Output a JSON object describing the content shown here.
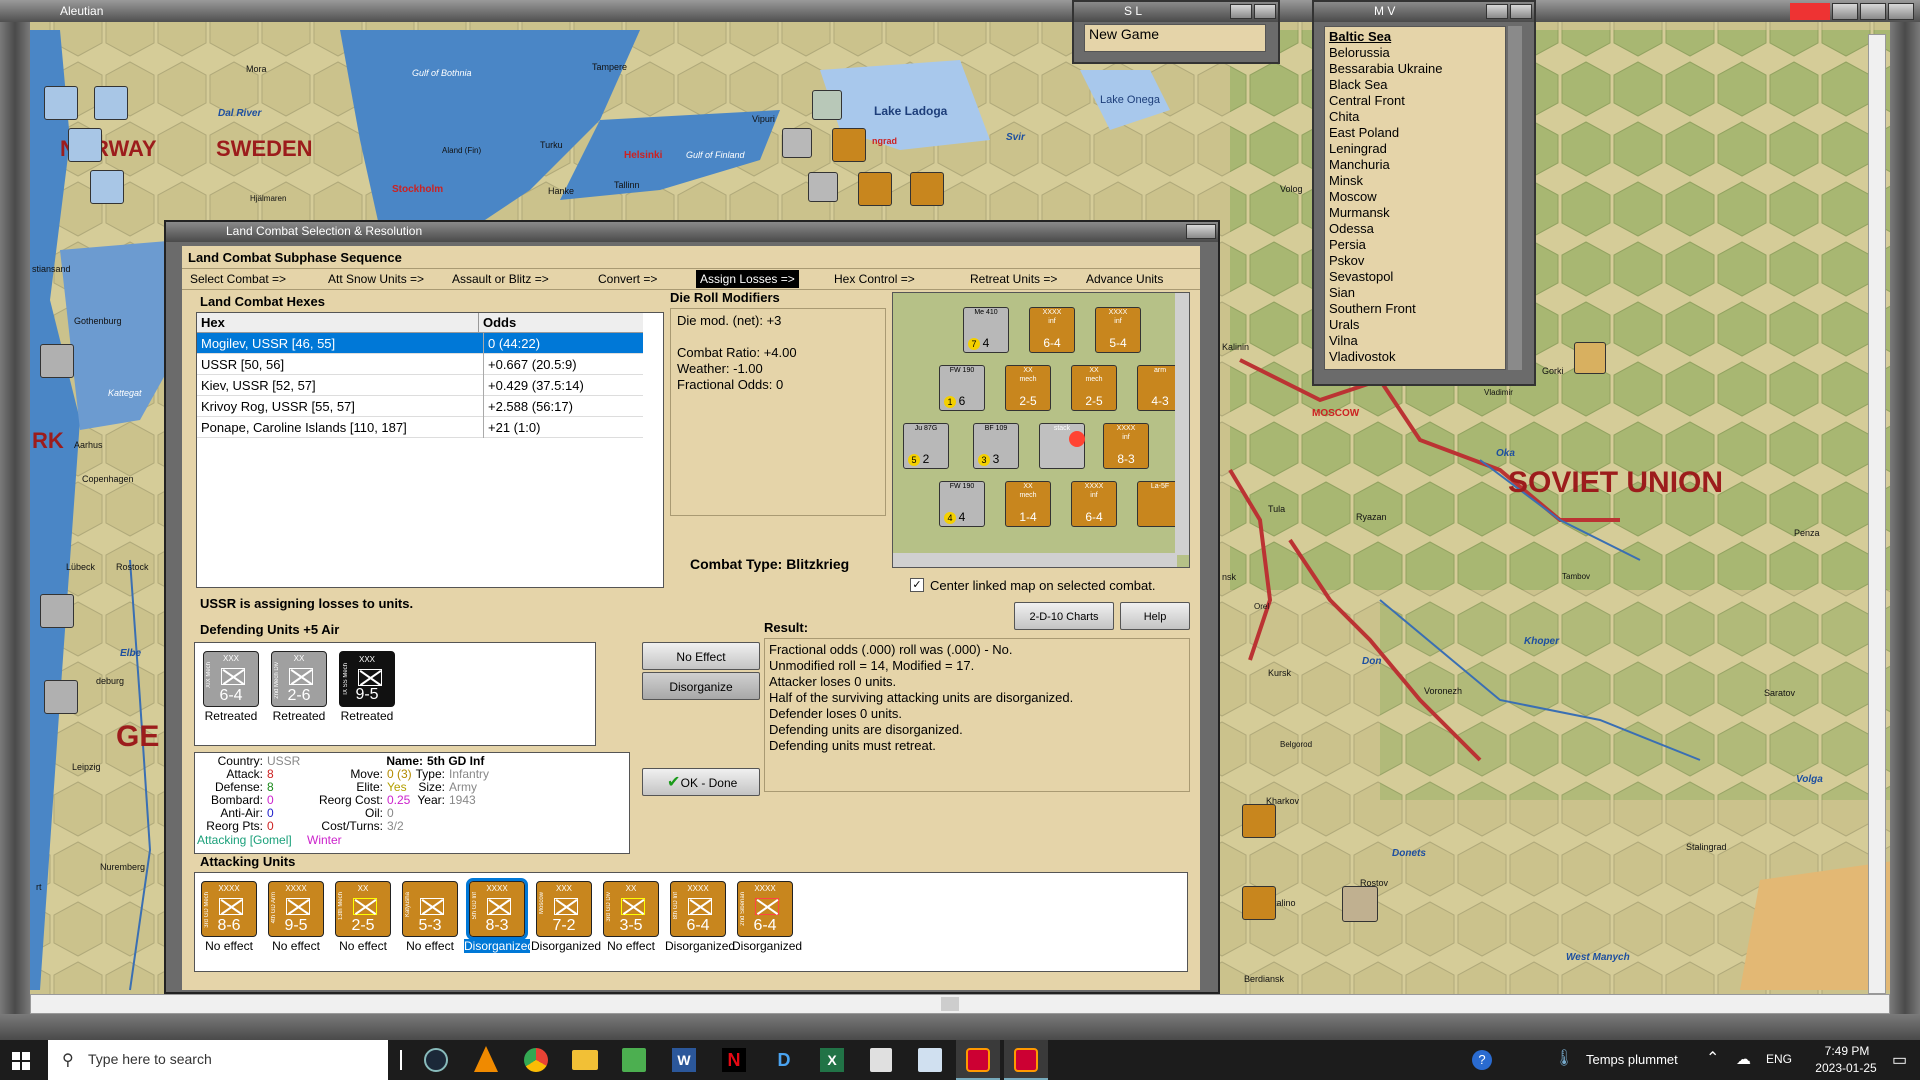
{
  "app": {
    "title": "Aleutian"
  },
  "map_labels": [
    {
      "text": "NORWAY",
      "kind": "country"
    },
    {
      "text": "SWEDEN",
      "kind": "country"
    },
    {
      "text": "RK",
      "kind": "country"
    },
    {
      "text": "GE",
      "kind": "country"
    },
    {
      "text": "SOVIET UNION",
      "kind": "country"
    },
    {
      "text": "Gulf of Bothnia",
      "kind": "sea"
    },
    {
      "text": "Gulf of Finland",
      "kind": "sea"
    },
    {
      "text": "Kattegat",
      "kind": "sea"
    },
    {
      "text": "Lake Ladoga",
      "kind": "sea"
    },
    {
      "text": "Lake Onega",
      "kind": "sea"
    },
    {
      "text": "Dal River",
      "kind": "river"
    },
    {
      "text": "Svir",
      "kind": "river"
    },
    {
      "text": "Oka",
      "kind": "river"
    },
    {
      "text": "Khoper",
      "kind": "river"
    },
    {
      "text": "Don",
      "kind": "river"
    },
    {
      "text": "Donets",
      "kind": "river"
    },
    {
      "text": "Volga",
      "kind": "river"
    },
    {
      "text": "Elbe",
      "kind": "river"
    },
    {
      "text": "West Manych",
      "kind": "river"
    },
    {
      "text": "Stockholm",
      "kind": "capital"
    },
    {
      "text": "Helsinki",
      "kind": "capital"
    },
    {
      "text": "MOSCOW",
      "kind": "capital"
    },
    {
      "text": "Mora",
      "kind": "city"
    },
    {
      "text": "Tampere",
      "kind": "city"
    },
    {
      "text": "Turku",
      "kind": "city"
    },
    {
      "text": "Hanke",
      "kind": "city"
    },
    {
      "text": "Tallinn",
      "kind": "city"
    },
    {
      "text": "Aland (Fin)",
      "kind": "city"
    },
    {
      "text": "Hjälmaren",
      "kind": "city"
    },
    {
      "text": "Gothenburg",
      "kind": "city"
    },
    {
      "text": "Aarhus",
      "kind": "city"
    },
    {
      "text": "Copenhagen",
      "kind": "city"
    },
    {
      "text": "Lübeck",
      "kind": "city"
    },
    {
      "text": "Rostock",
      "kind": "city"
    },
    {
      "text": "Leipzig",
      "kind": "city"
    },
    {
      "text": "Nuremberg",
      "kind": "city"
    },
    {
      "text": "Vipuri",
      "kind": "city"
    },
    {
      "text": "Volog",
      "kind": "city"
    },
    {
      "text": "Gorki",
      "kind": "city"
    },
    {
      "text": "Vladimir",
      "kind": "city"
    },
    {
      "text": "Kalinin",
      "kind": "city"
    },
    {
      "text": "Tula",
      "kind": "city"
    },
    {
      "text": "Ryazan",
      "kind": "city"
    },
    {
      "text": "Penza",
      "kind": "city"
    },
    {
      "text": "Tambov",
      "kind": "city"
    },
    {
      "text": "Orel",
      "kind": "city"
    },
    {
      "text": "Kursk",
      "kind": "city"
    },
    {
      "text": "Voronezh",
      "kind": "city"
    },
    {
      "text": "Saratov",
      "kind": "city"
    },
    {
      "text": "Belgorod",
      "kind": "city"
    },
    {
      "text": "Kharkov",
      "kind": "city"
    },
    {
      "text": "Stalingrad",
      "kind": "city"
    },
    {
      "text": "Rostov",
      "kind": "city"
    },
    {
      "text": "Stalino",
      "kind": "city"
    },
    {
      "text": "Berdiansk",
      "kind": "city"
    },
    {
      "text": "stiansand",
      "kind": "city"
    },
    {
      "text": "deburg",
      "kind": "city"
    },
    {
      "text": "rt",
      "kind": "city"
    },
    {
      "text": "nsk",
      "kind": "city"
    },
    {
      "text": "ngrad",
      "kind": "city"
    }
  ],
  "sl_window": {
    "title": "S L",
    "item": "New Game"
  },
  "mv_window": {
    "title": "M V",
    "items": [
      "Baltic Sea",
      "Belorussia",
      "Bessarabia Ukraine",
      "Black Sea",
      "Central Front",
      "Chita",
      "East Poland",
      "Leningrad",
      "Manchuria",
      "Minsk",
      "Moscow",
      "Murmansk",
      "Odessa",
      "Persia",
      "Pskov",
      "Sevastopol",
      "Sian",
      "Southern Front",
      "Urals",
      "Vilna",
      "Vladivostok"
    ]
  },
  "dialog": {
    "title": "Land Combat Selection & Resolution",
    "sequence": {
      "heading": "Land Combat Subphase Sequence",
      "steps": [
        "Select Combat =>",
        "Att Snow Units =>",
        "Assault or Blitz =>",
        "Convert =>",
        "Assign Losses =>",
        "Hex Control =>",
        "Retreat Units =>",
        "Advance Units"
      ],
      "active_index": 4
    },
    "hexes": {
      "heading": "Land Combat Hexes",
      "col_hex": "Hex",
      "col_odds": "Odds",
      "rows": [
        {
          "hex": "Mogilev, USSR [46, 55]",
          "odds": "0 (44:22)"
        },
        {
          "hex": "USSR [50, 56]",
          "odds": "+0.667 (20.5:9)"
        },
        {
          "hex": "Kiev, USSR [52, 57]",
          "odds": "+0.429 (37.5:14)"
        },
        {
          "hex": "Krivoy Rog, USSR [55, 57]",
          "odds": "+2.588 (56:17)"
        },
        {
          "hex": "Ponape, Caroline Islands [110, 187]",
          "odds": "+21 (1:0)"
        }
      ]
    },
    "modifiers": {
      "heading": "Die Roll Modifiers",
      "net": "Die mod. (net): +3",
      "ratio": "Combat Ratio: +4.00",
      "weather": "Weather: -1.00",
      "fractional": "Fractional Odds: 0"
    },
    "combat_type": "Combat Type:  Blitzkrieg",
    "center_map": "Center linked map on selected combat.",
    "charts_btn": "2-D-10 Charts",
    "help_btn": "Help",
    "status": "USSR is assigning losses to units.",
    "defending_heading": "Defending Units +5 Air",
    "defenders": [
      {
        "size": "XXX",
        "value": "6-4",
        "status": "Retreated",
        "name": "XIX Mech"
      },
      {
        "size": "XX",
        "value": "2-6",
        "status": "Retreated",
        "name": "2nd Mech Div"
      },
      {
        "size": "XXX",
        "value": "9-5",
        "status": "Retreated",
        "name": "IX SS Mech"
      }
    ],
    "no_effect_btn": "No Effect",
    "disorganize_btn": "Disorganize",
    "ok_btn": "OK - Done",
    "result_heading": "Result:",
    "result_lines": [
      "Fractional odds (.000) roll was (.000)  - No.",
      "Unmodified roll = 14, Modified = 17.",
      "Attacker loses 0 units.",
      "Half of the surviving attacking units are disorganized.",
      "Defender loses 0 units.",
      "Defending units are disorganized.",
      "Defending units must retreat."
    ],
    "unit": {
      "country_label": "Country:",
      "country": "USSR",
      "attack_label": "Attack:",
      "attack": "8",
      "defense_label": "Defense:",
      "defense": "8",
      "bombard_label": "Bombard:",
      "bombard": "0",
      "antiair_label": "Anti-Air:",
      "antiair": "0",
      "reorg_label": "Reorg Pts:",
      "reorg": "0",
      "attacking": "Attacking [Gomel]",
      "season": "Winter",
      "name_label": "Name:",
      "name": "5th GD Inf",
      "move_label": "Move:",
      "move": "0",
      "move_max": "(3)",
      "type_label": "Type:",
      "type": "Infantry",
      "elite_label": "Elite:",
      "elite": "Yes",
      "size_label": "Size:",
      "size": "Army",
      "reorg_cost_label": "Reorg Cost:",
      "reorg_cost": "0.25",
      "year_label": "Year:",
      "year": "1943",
      "oil_label": "Oil:",
      "oil": "0",
      "cost_label": "Cost/Turns:",
      "cost": "3/2"
    },
    "attacking_heading": "Attacking Units",
    "attackers": [
      {
        "size": "XXXX",
        "value": "8-6",
        "status": "No effect",
        "name": "3rd GD Mech"
      },
      {
        "size": "XXXX",
        "value": "9-5",
        "status": "No effect",
        "name": "4th GD Arm"
      },
      {
        "size": "XX",
        "value": "2-5",
        "status": "No effect",
        "name": "13th Mech"
      },
      {
        "size": "",
        "value": "5-3",
        "status": "No effect",
        "name": "Katyusha"
      },
      {
        "size": "XXXX",
        "value": "8-3",
        "status": "Disorganized",
        "name": "5th GD Inf"
      },
      {
        "size": "XXX",
        "value": "7-2",
        "status": "Disorganized",
        "name": "Moscow"
      },
      {
        "size": "XX",
        "value": "3-5",
        "status": "No effect",
        "name": "3rd GD Div"
      },
      {
        "size": "XXXX",
        "value": "6-4",
        "status": "Disorganized",
        "name": "8th GD Inf"
      },
      {
        "size": "XXXX",
        "value": "6-4",
        "status": "Disorganized",
        "name": "2nd Siberian"
      }
    ],
    "minimap_counters": [
      {
        "top": "",
        "value": "4",
        "extra": "7",
        "name": "Me 410"
      },
      {
        "top": "XXXX",
        "value": "6-4",
        "name": "inf"
      },
      {
        "top": "XXXX",
        "value": "5-4",
        "name": "inf"
      },
      {
        "top": "",
        "value": "6",
        "extra": "1",
        "name": "FW 190"
      },
      {
        "top": "XX",
        "value": "2-5",
        "name": "mech"
      },
      {
        "top": "XX",
        "value": "2-5",
        "name": "mech"
      },
      {
        "top": "",
        "value": "4-3",
        "name": "arm"
      },
      {
        "top": "",
        "value": "2",
        "extra": "5",
        "name": "Ju 87G"
      },
      {
        "top": "",
        "value": "3",
        "extra": "3",
        "name": "BF 109"
      },
      {
        "top": "",
        "value": "",
        "name": "stack"
      },
      {
        "top": "XXXX",
        "value": "8-3",
        "name": "inf"
      },
      {
        "top": "",
        "value": "4",
        "extra": "4",
        "name": "FW 190"
      },
      {
        "top": "XX",
        "value": "1-4",
        "name": "mech"
      },
      {
        "top": "XXXX",
        "value": "6-4",
        "name": "inf"
      },
      {
        "top": "",
        "value": "",
        "name": "La-5F"
      }
    ]
  },
  "taskbar": {
    "search_placeholder": "Type here to search",
    "weather": "Temps plummet",
    "lang": "ENG",
    "time": "7:49 PM",
    "date": "2023-01-25"
  },
  "colors": {
    "soviet_counter": "#c8861e",
    "german_counter": "#8c8c8c",
    "ss_counter": "#111111",
    "land": "#d9cf9e",
    "forest": "#a6b870",
    "water": "#4a86c6",
    "dialog": "#e5d4a9",
    "frame": "#6b6b6b",
    "accent": "#0078d7"
  }
}
